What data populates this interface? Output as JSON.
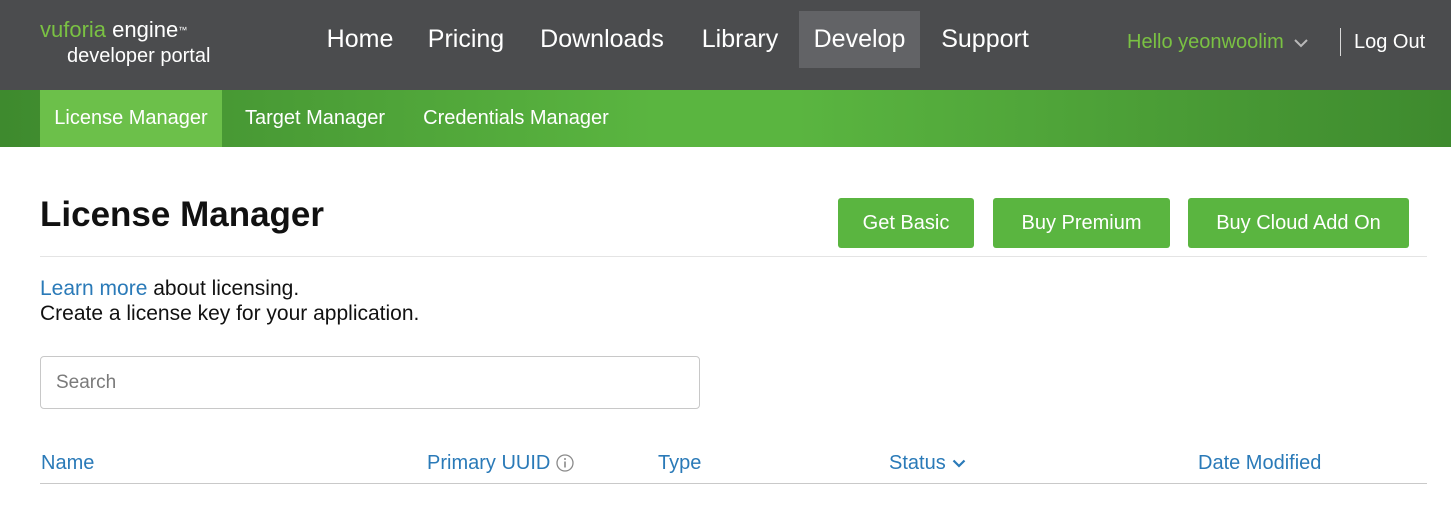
{
  "header": {
    "logo": {
      "brand_primary": "vuforia",
      "brand_secondary": "engine",
      "trademark": "™",
      "subtitle": "developer portal"
    },
    "nav": [
      {
        "label": "Home"
      },
      {
        "label": "Pricing"
      },
      {
        "label": "Downloads"
      },
      {
        "label": "Library"
      },
      {
        "label": "Develop",
        "active": true
      },
      {
        "label": "Support"
      }
    ],
    "user_greeting": "Hello yeonwoolim",
    "user_menu_icon": "chevron-down-icon",
    "logout_label": "Log Out"
  },
  "subnav": [
    {
      "label": "License Manager",
      "active": true
    },
    {
      "label": "Target Manager"
    },
    {
      "label": "Credentials Manager"
    }
  ],
  "main": {
    "title": "License Manager",
    "buttons": {
      "get_basic": "Get Basic",
      "buy_premium": "Buy Premium",
      "buy_cloud": "Buy Cloud Add On"
    },
    "intro": {
      "learn_more": "Learn more",
      "learn_more_suffix": " about licensing.",
      "create_text": "Create a license key for your application."
    },
    "search": {
      "placeholder": "Search",
      "value": ""
    },
    "table": {
      "columns": [
        {
          "label": "Name"
        },
        {
          "label": "Primary UUID",
          "icon": "info-icon"
        },
        {
          "label": "Type"
        },
        {
          "label": "Status",
          "icon": "chevron-down-icon"
        },
        {
          "label": "Date Modified"
        }
      ],
      "rows": []
    }
  },
  "colors": {
    "topbar_bg": "#4b4c4e",
    "active_nav_bg": "#626366",
    "accent_green": "#5ab540",
    "greeting_green": "#7ac143",
    "link_blue": "#2a7ab8"
  }
}
